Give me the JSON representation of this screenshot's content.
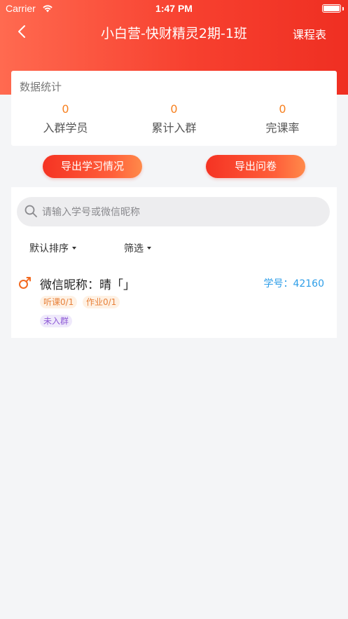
{
  "status_bar": {
    "carrier": "Carrier",
    "time": "1:47 PM"
  },
  "nav": {
    "title": "小白营-快财精灵2期-1班",
    "right_label": "课程表"
  },
  "stats": {
    "title": "数据统计",
    "items": [
      {
        "value": "0",
        "label": "入群学员"
      },
      {
        "value": "0",
        "label": "累计入群"
      },
      {
        "value": "0",
        "label": "完课率"
      }
    ]
  },
  "actions": {
    "export_study": "导出学习情况",
    "export_survey": "导出问卷"
  },
  "search": {
    "placeholder": "请输入学号或微信昵称"
  },
  "filters": {
    "sort": "默认排序",
    "filter": "筛选"
  },
  "students": [
    {
      "name": "微信昵称：晴「」",
      "id_text": "学号：42160",
      "tags": [
        "听课0/1",
        "作业0/1"
      ],
      "group_status": "未入群"
    }
  ],
  "colors": {
    "accent": "#f7402f",
    "stat_number": "#f7801f",
    "student_id": "#2e9ee8",
    "gender_icon": "#f26a21"
  },
  "icons": [
    "wifi-icon",
    "battery-icon",
    "back-chevron-icon",
    "search-icon",
    "male-gender-icon"
  ]
}
